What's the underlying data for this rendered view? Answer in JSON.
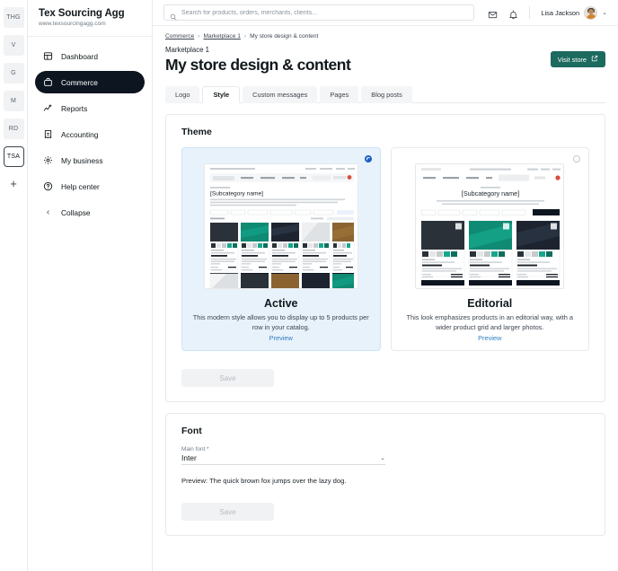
{
  "org_rail": {
    "items": [
      {
        "label": "THG",
        "current": false
      },
      {
        "label": "V",
        "current": false
      },
      {
        "label": "G",
        "current": false
      },
      {
        "label": "M",
        "current": false
      },
      {
        "label": "RD",
        "current": false
      },
      {
        "label": "TSA",
        "current": true
      }
    ],
    "add_label": "+"
  },
  "sidebar": {
    "brand_name": "Tex Sourcing Agg",
    "brand_url": "www.texsourcingagg.com",
    "items": [
      {
        "label": "Dashboard",
        "icon": "dashboard-icon",
        "active": false
      },
      {
        "label": "Commerce",
        "icon": "briefcase-icon",
        "active": true
      },
      {
        "label": "Reports",
        "icon": "chart-icon",
        "active": false
      },
      {
        "label": "Accounting",
        "icon": "receipt-icon",
        "active": false
      },
      {
        "label": "My business",
        "icon": "gear-icon",
        "active": false
      },
      {
        "label": "Help center",
        "icon": "question-circle-icon",
        "active": false
      }
    ],
    "collapse_label": "Collapse"
  },
  "topbar": {
    "search_placeholder": "Search for products, orders, merchants, clients...",
    "search_value": "",
    "mail_icon": "mail-icon",
    "bell_icon": "bell-icon",
    "user_name": "Lisa Jackson",
    "caret": "⌄"
  },
  "breadcrumb": {
    "items": [
      "Commerce",
      "Marketplace 1",
      "My store design & content"
    ],
    "separator": "›"
  },
  "page": {
    "subtitle": "Marketplace 1",
    "title": "My store design & content",
    "visit_store_label": "Visit store"
  },
  "tabs": [
    {
      "label": "Logo",
      "active": false
    },
    {
      "label": "Style",
      "active": true
    },
    {
      "label": "Custom messages",
      "active": false
    },
    {
      "label": "Pages",
      "active": false
    },
    {
      "label": "Blog posts",
      "active": false
    }
  ],
  "theme_section": {
    "title": "Theme",
    "save_label": "Save",
    "options": [
      {
        "name": "Active",
        "description": "This modern style allows you to display up to 5 products per row in your catalog.",
        "preview_label": "Preview",
        "selected": true,
        "thumb_heading": "[Subcategory name]",
        "products_per_row": 5
      },
      {
        "name": "Editorial",
        "description": "This look emphasizes products in an editorial way, with a wider product grid and larger photos.",
        "preview_label": "Preview",
        "selected": false,
        "thumb_heading": "[Subcategory name]",
        "products_per_row": 3
      }
    ]
  },
  "font_section": {
    "title": "Font",
    "field_label": "Main font *",
    "selected_font": "Inter",
    "caret": "⌄",
    "preview_text": "Preview: The quick brown fox jumps over the lazy dog.",
    "save_label": "Save"
  },
  "colors": {
    "accent_green": "#1d6a5f",
    "selected_blue": "#1a5fc4",
    "selected_card_bg": "#e8f2fb",
    "link_blue": "#2f7ec4",
    "sidebar_active_bg": "#0d1520"
  }
}
